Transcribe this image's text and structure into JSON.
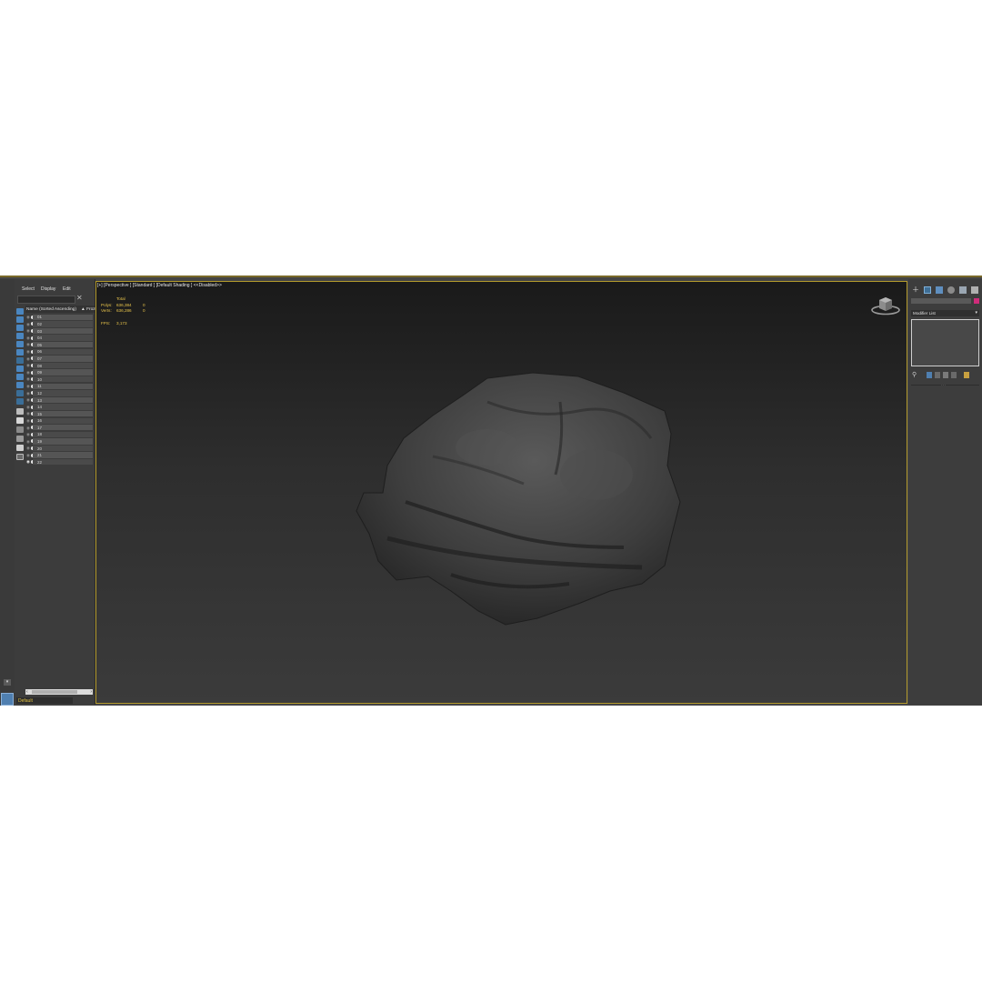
{
  "explorer": {
    "menu": [
      "Select",
      "Display",
      "Edit"
    ],
    "column_header": "Name (Sorted Ascending)",
    "column_header2": "▲ Froze",
    "rows": [
      "01",
      "02",
      "03",
      "04",
      "05",
      "06",
      "07",
      "08",
      "09",
      "10",
      "11",
      "12",
      "13",
      "14",
      "15",
      "16",
      "17",
      "18",
      "19",
      "20",
      "21",
      "22"
    ],
    "layer": "Default"
  },
  "viewport": {
    "label": "[+] [Perspective ] [Standard ] [Default Shading ]  <<Disabled>>",
    "stats": {
      "total_label": "Total",
      "polys_label": "Polys:",
      "polys_total": "636,384",
      "polys_selected": "0",
      "verts_label": "Verts:",
      "verts_total": "636,286",
      "verts_selected": "0",
      "fps_label": "FPS:",
      "fps_value": "3,173"
    }
  },
  "command_panel": {
    "modifier_list": "Modifier List"
  },
  "colors": {
    "accent_yellow": "#e6c24a",
    "viewport_border": "#b39a2c",
    "object_color": "#d02c7a",
    "tool_blue": "#4f7fb0"
  }
}
